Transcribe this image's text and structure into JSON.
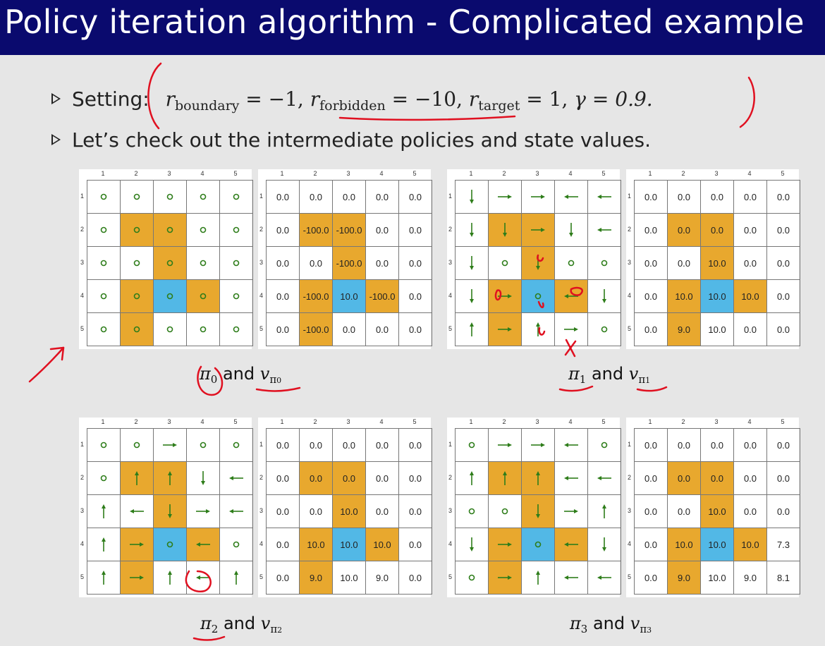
{
  "title": "Policy iteration algorithm - Complicated example",
  "bullets": {
    "setting_label": "Setting:",
    "r_boundary_sub": "boundary",
    "r_boundary_val": " = −1, ",
    "r_forbidden_sub": "forbidden",
    "r_forbidden_val": " = −10, ",
    "r_target_sub": "target",
    "r_target_val": " = 1, ",
    "gamma": "γ = 0.9.",
    "check_text": "Let’s check out the intermediate policies and state values."
  },
  "colors": {
    "forbidden": "#E8A82E",
    "target": "#52B8E6",
    "arrow": "#2E7D1A",
    "ink": "#E01020",
    "title_bg": "#0A0A6E"
  },
  "axis_ticks": [
    "1",
    "2",
    "3",
    "4",
    "5"
  ],
  "cell_types": [
    [
      "n",
      "n",
      "n",
      "n",
      "n"
    ],
    [
      "n",
      "f",
      "f",
      "n",
      "n"
    ],
    [
      "n",
      "n",
      "f",
      "n",
      "n"
    ],
    [
      "n",
      "f",
      "t",
      "f",
      "n"
    ],
    [
      "n",
      "f",
      "n",
      "n",
      "n"
    ]
  ],
  "examples": [
    {
      "caption_pi": "π",
      "caption_pi_sub": "0",
      "caption_and": " and ",
      "caption_v": "v",
      "caption_v_sub": "π",
      "caption_v_subsub": "0",
      "policy": [
        [
          "stay",
          "stay",
          "stay",
          "stay",
          "stay"
        ],
        [
          "stay",
          "stay",
          "stay",
          "stay",
          "stay"
        ],
        [
          "stay",
          "stay",
          "stay",
          "stay",
          "stay"
        ],
        [
          "stay",
          "stay",
          "stay",
          "stay",
          "stay"
        ],
        [
          "stay",
          "stay",
          "stay",
          "stay",
          "stay"
        ]
      ],
      "values": [
        [
          "0.0",
          "0.0",
          "0.0",
          "0.0",
          "0.0"
        ],
        [
          "0.0",
          "-100.0",
          "-100.0",
          "0.0",
          "0.0"
        ],
        [
          "0.0",
          "0.0",
          "-100.0",
          "0.0",
          "0.0"
        ],
        [
          "0.0",
          "-100.0",
          "10.0",
          "-100.0",
          "0.0"
        ],
        [
          "0.0",
          "-100.0",
          "0.0",
          "0.0",
          "0.0"
        ]
      ]
    },
    {
      "caption_pi": "π",
      "caption_pi_sub": "1",
      "caption_and": " and ",
      "caption_v": "v",
      "caption_v_sub": "π",
      "caption_v_subsub": "1",
      "policy": [
        [
          "down",
          "right",
          "right",
          "left",
          "left"
        ],
        [
          "down",
          "down",
          "right",
          "down",
          "left"
        ],
        [
          "down",
          "stay",
          "down",
          "stay",
          "stay"
        ],
        [
          "down",
          "right",
          "stay",
          "left",
          "down"
        ],
        [
          "up",
          "right",
          "up",
          "right",
          "stay"
        ]
      ],
      "values": [
        [
          "0.0",
          "0.0",
          "0.0",
          "0.0",
          "0.0"
        ],
        [
          "0.0",
          "0.0",
          "0.0",
          "0.0",
          "0.0"
        ],
        [
          "0.0",
          "0.0",
          "10.0",
          "0.0",
          "0.0"
        ],
        [
          "0.0",
          "10.0",
          "10.0",
          "10.0",
          "0.0"
        ],
        [
          "0.0",
          "9.0",
          "10.0",
          "0.0",
          "0.0"
        ]
      ]
    },
    {
      "caption_pi": "π",
      "caption_pi_sub": "2",
      "caption_and": " and ",
      "caption_v": "v",
      "caption_v_sub": "π",
      "caption_v_subsub": "2",
      "policy": [
        [
          "stay",
          "stay",
          "right",
          "stay",
          "stay"
        ],
        [
          "stay",
          "up",
          "up",
          "down",
          "left"
        ],
        [
          "up",
          "left",
          "down",
          "right",
          "left"
        ],
        [
          "up",
          "right",
          "stay",
          "left",
          "stay"
        ],
        [
          "up",
          "right",
          "up",
          "left",
          "up"
        ]
      ],
      "values": [
        [
          "0.0",
          "0.0",
          "0.0",
          "0.0",
          "0.0"
        ],
        [
          "0.0",
          "0.0",
          "0.0",
          "0.0",
          "0.0"
        ],
        [
          "0.0",
          "0.0",
          "10.0",
          "0.0",
          "0.0"
        ],
        [
          "0.0",
          "10.0",
          "10.0",
          "10.0",
          "0.0"
        ],
        [
          "0.0",
          "9.0",
          "10.0",
          "9.0",
          "0.0"
        ]
      ]
    },
    {
      "caption_pi": "π",
      "caption_pi_sub": "3",
      "caption_and": " and ",
      "caption_v": "v",
      "caption_v_sub": "π",
      "caption_v_subsub": "3",
      "policy": [
        [
          "stay",
          "right",
          "right",
          "left",
          "stay"
        ],
        [
          "up",
          "up",
          "up",
          "left",
          "left"
        ],
        [
          "stay",
          "stay",
          "down",
          "right",
          "up"
        ],
        [
          "down",
          "right",
          "stay",
          "left",
          "down"
        ],
        [
          "stay",
          "right",
          "up",
          "left",
          "left"
        ]
      ],
      "values": [
        [
          "0.0",
          "0.0",
          "0.0",
          "0.0",
          "0.0"
        ],
        [
          "0.0",
          "0.0",
          "0.0",
          "0.0",
          "0.0"
        ],
        [
          "0.0",
          "0.0",
          "10.0",
          "0.0",
          "0.0"
        ],
        [
          "0.0",
          "10.0",
          "10.0",
          "10.0",
          "7.3"
        ],
        [
          "0.0",
          "9.0",
          "10.0",
          "9.0",
          "8.1"
        ]
      ]
    }
  ]
}
